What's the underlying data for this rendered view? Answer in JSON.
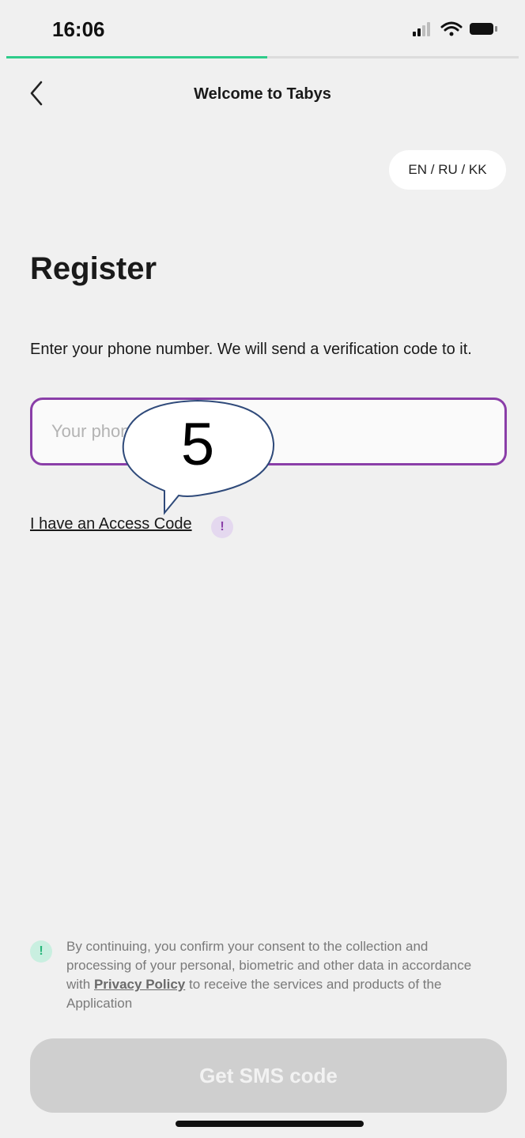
{
  "status_bar": {
    "time": "16:06",
    "icons": [
      "cellular-signal-icon",
      "wifi-icon",
      "battery-icon"
    ]
  },
  "progress": {
    "fraction": 0.51,
    "color": "#2ecc8a"
  },
  "header": {
    "title": "Welcome to Tabys",
    "back_icon": "chevron-left-icon"
  },
  "language_switcher": {
    "label": "EN / RU / KK"
  },
  "main": {
    "title": "Register",
    "description": "Enter your phone number. We will send a verification code to it.",
    "phone_input": {
      "placeholder": "Your phone",
      "value": ""
    },
    "access_code_link": "I have an Access Code",
    "access_code_info_icon": "!"
  },
  "annotation": {
    "number": "5"
  },
  "consent": {
    "icon": "!",
    "text_before": "By continuing, you confirm your consent to the collection and processing of your personal, biometric and other data in accordance with ",
    "link": "Privacy Policy",
    "text_after": " to receive the services and products of the Application"
  },
  "submit_button": {
    "label": "Get SMS code"
  },
  "colors": {
    "accent_purple": "#8a3ea8",
    "accent_green": "#2ecc8a",
    "background": "#f0f0f0",
    "disabled_button": "#cfcfcf"
  }
}
